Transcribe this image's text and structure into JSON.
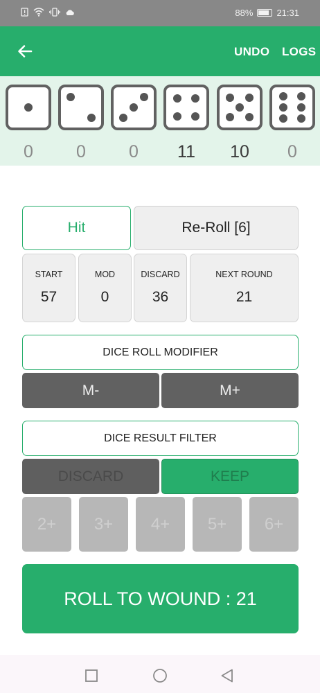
{
  "status_bar": {
    "battery": "88%",
    "time": "21:31",
    "icons": [
      "sim-alert-icon",
      "wifi-icon",
      "vibrate-icon",
      "cloud-icon"
    ]
  },
  "app_bar": {
    "back_icon": "arrow-left-icon",
    "undo_label": "UNDO",
    "logs_label": "LOGS"
  },
  "dice": [
    {
      "face": 1,
      "count": "0"
    },
    {
      "face": 2,
      "count": "0"
    },
    {
      "face": 3,
      "count": "0"
    },
    {
      "face": 4,
      "count": "11"
    },
    {
      "face": 5,
      "count": "10"
    },
    {
      "face": 6,
      "count": "0"
    }
  ],
  "actions": {
    "hit_label": "Hit",
    "reroll_label": "Re-Roll [6]"
  },
  "stats": {
    "start": {
      "label": "START",
      "value": "57"
    },
    "mod": {
      "label": "MOD",
      "value": "0"
    },
    "discard": {
      "label": "DISCARD",
      "value": "36"
    },
    "next_round": {
      "label": "NEXT ROUND",
      "value": "21"
    }
  },
  "modifier": {
    "title": "DICE ROLL MODIFIER",
    "minus_label": "M-",
    "plus_label": "M+"
  },
  "filter": {
    "title": "DICE RESULT FILTER",
    "discard_label": "DISCARD",
    "keep_label": "KEEP",
    "options": [
      "2+",
      "3+",
      "4+",
      "5+",
      "6+"
    ]
  },
  "roll": {
    "label": "ROLL TO WOUND : 21"
  },
  "colors": {
    "accent": "#27ae6c",
    "dark_button": "#616161",
    "disabled": "#b7b7b7",
    "dice_strip": "#e3f4ea"
  }
}
